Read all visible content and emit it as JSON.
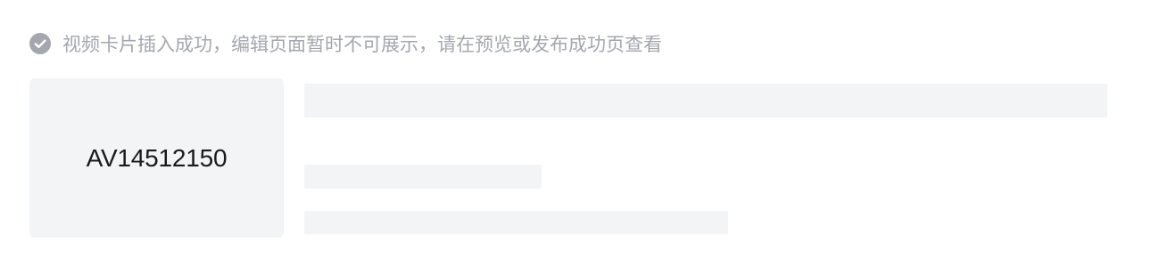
{
  "notice": {
    "icon": "check-circle-icon",
    "icon_color": "#a4a7ad",
    "text": "视频卡片插入成功，编辑页面暂时不可展示，请在预览或发布成功页查看"
  },
  "video_card": {
    "id_label": "AV14512150",
    "placeholder_color": "#f3f4f6"
  }
}
